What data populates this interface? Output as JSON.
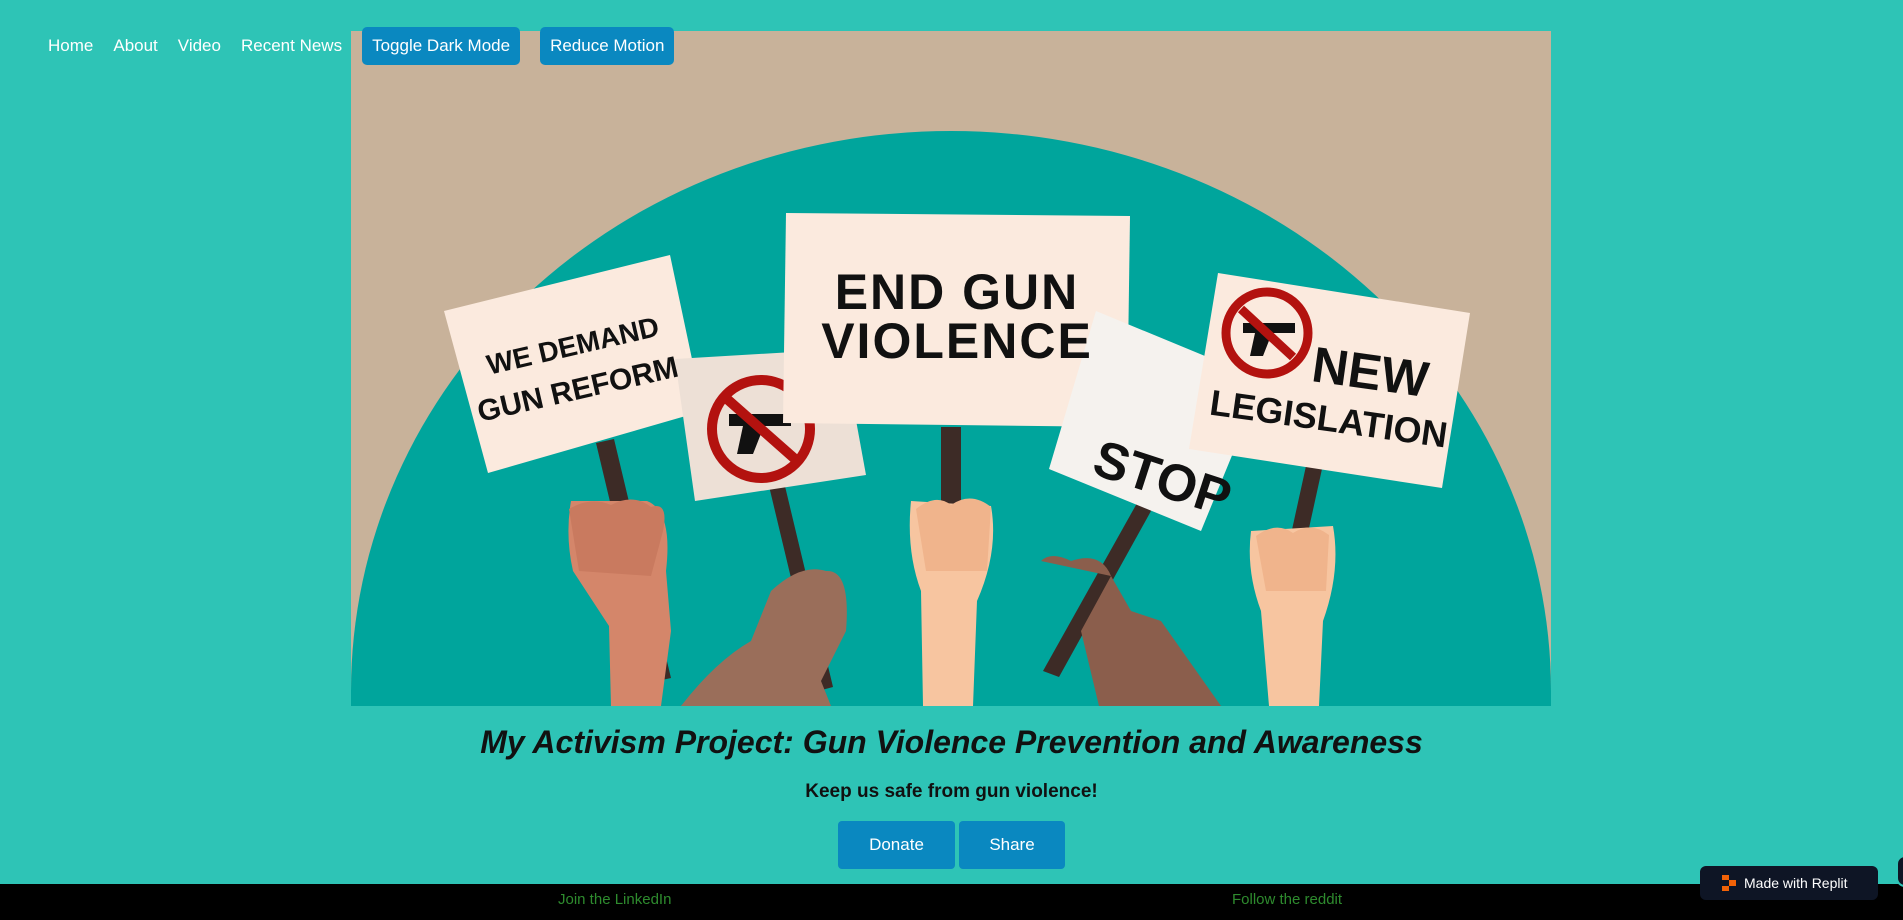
{
  "nav": {
    "links": [
      "Home",
      "About",
      "Video",
      "Recent News"
    ],
    "dark_mode_label": "Toggle Dark Mode",
    "reduce_motion_label": "Reduce Motion"
  },
  "hero": {
    "signs": {
      "demand_line1": "WE DEMAND",
      "demand_line2": "GUN REFORM",
      "end_line1": "END GUN",
      "end_line2": "VIOLENCE",
      "stop": "STOP",
      "new_line1": "NEW",
      "new_line2": "LEGISLATION"
    }
  },
  "main": {
    "title": "My Activism Project: Gun Violence Prevention and Awareness",
    "subtitle": "Keep us safe from gun violence!",
    "donate_label": "Donate",
    "share_label": "Share"
  },
  "footer": {
    "linkedin_label": "Join the LinkedIn",
    "reddit_label": "Follow the reddit"
  },
  "badge": {
    "label": "Made with Replit"
  },
  "colors": {
    "background": "#2ec4b6",
    "button": "#0a88c0",
    "footer": "#000000",
    "footer_link": "#2e8b2e"
  }
}
